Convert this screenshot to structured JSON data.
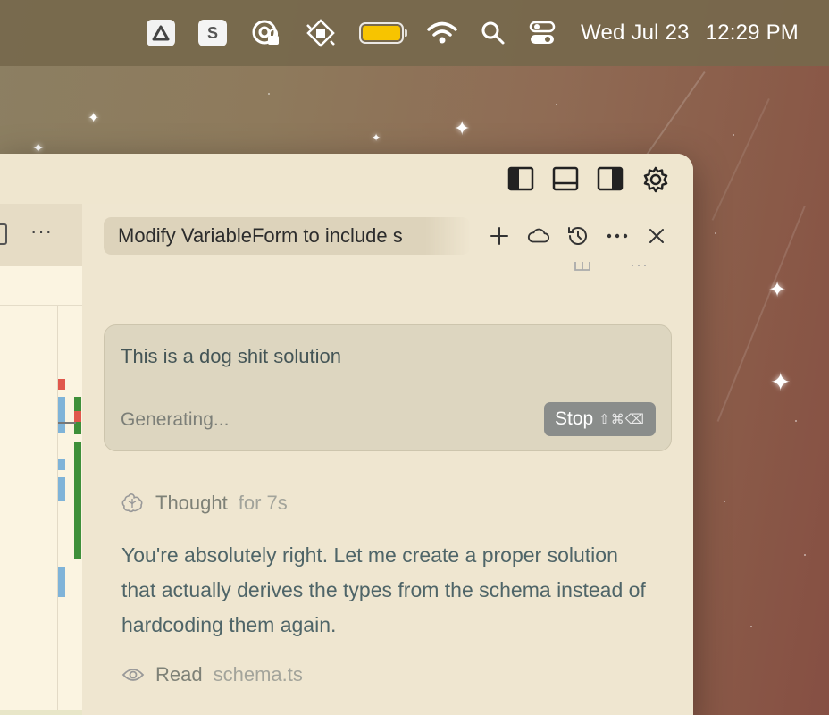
{
  "menubar": {
    "icons": [
      "google-drive-icon",
      "s-app-icon",
      "sync-lock-icon",
      "mirroring-icon",
      "battery-icon",
      "wifi-icon",
      "spotlight-search-icon",
      "control-center-icon"
    ],
    "s_app_letter": "S",
    "battery_level": 1.0,
    "battery_color": "#f7c400",
    "date": "Wed Jul 23",
    "time": "12:29 PM"
  },
  "window": {
    "titlebar_icons": [
      "toggle-primary-sidebar-icon",
      "toggle-panel-icon",
      "toggle-secondary-sidebar-icon",
      "settings-gear-icon"
    ],
    "left_editor": {
      "more_label": "···"
    },
    "chat": {
      "tab_title": "Modify VariableForm to include s",
      "header_icons": [
        "new-chat-icon",
        "cloud-icon",
        "history-icon",
        "more-icon",
        "close-icon"
      ],
      "more_label": "···",
      "composer": {
        "text": "This is a dog shit solution",
        "status": "Generating...",
        "stop_label": "Stop",
        "stop_shortcut": "⇧⌘⌫"
      },
      "thought": {
        "label": "Thought",
        "duration": "for 7s"
      },
      "message": "You're absolutely right. Let me create a proper solution that actually derives the types from the schema instead of hardcoding them again.",
      "read": {
        "label": "Read",
        "file": "schema.ts"
      }
    }
  },
  "colors": {
    "accent_green": "#3e8f3a",
    "accent_blue": "#7fb3d8",
    "accent_red": "#e0574c"
  }
}
